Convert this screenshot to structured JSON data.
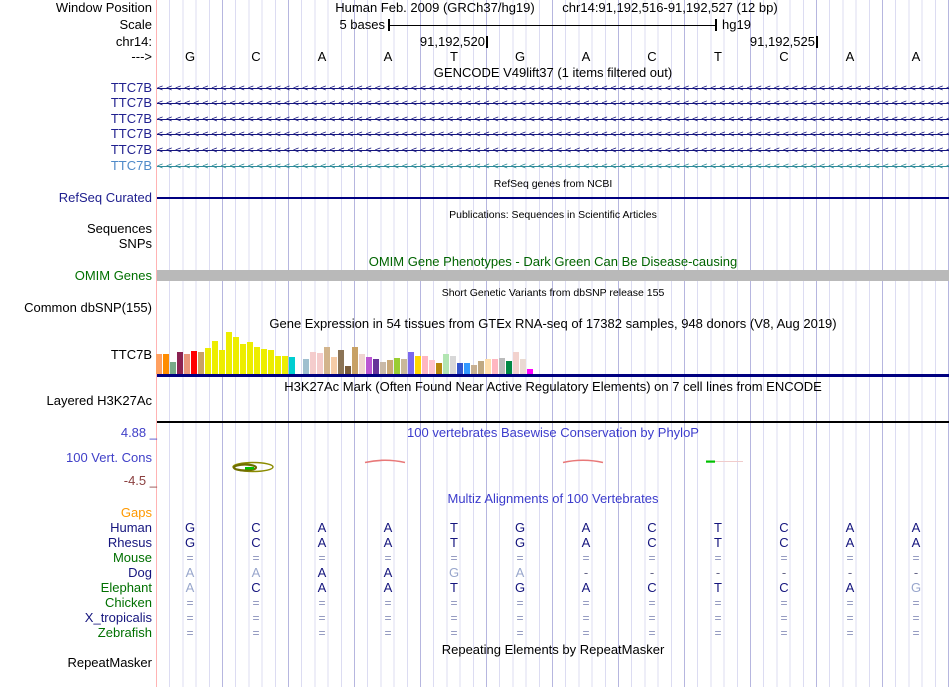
{
  "header": {
    "assembly_date": "Human Feb. 2009 (GRCh37/hg19)",
    "position": "chr14:91,192,516-91,192,527 (12 bp)",
    "scale_value": "5 bases",
    "assembly_short": "hg19",
    "coord_left": "91,192,520",
    "coord_right": "91,192,525",
    "left_labels": {
      "window_position": "Window Position",
      "scale": "Scale",
      "chrom": "chr14:",
      "strand_arrow": "--->"
    }
  },
  "bases": [
    "G",
    "C",
    "A",
    "A",
    "T",
    "G",
    "A",
    "C",
    "T",
    "C",
    "A",
    "A"
  ],
  "gencode": {
    "title": "GENCODE V49lift37 (1 items filtered out)",
    "arrow_char": "<",
    "rows": [
      {
        "label": "TTC7B",
        "label_color": "#20208f",
        "line_color": "#15157e"
      },
      {
        "label": "TTC7B",
        "label_color": "#20208f",
        "line_color": "#15157e"
      },
      {
        "label": "TTC7B",
        "label_color": "#20208f",
        "line_color": "#15157e"
      },
      {
        "label": "TTC7B",
        "label_color": "#20208f",
        "line_color": "#15157e"
      },
      {
        "label": "TTC7B",
        "label_color": "#20208f",
        "line_color": "#15157e"
      },
      {
        "label": "TTC7B",
        "label_color": "#4f8ac8",
        "line_color": "#2e8b99"
      }
    ]
  },
  "refseq": {
    "title": "RefSeq genes from NCBI",
    "label": "RefSeq Curated",
    "line_color": "#000080"
  },
  "publications": {
    "title": "Publications: Sequences in Scientific Articles",
    "label_sequences": "Sequences",
    "label_snps": "SNPs"
  },
  "omim": {
    "title": "OMIM Gene Phenotypes - Dark Green Can Be Disease-causing",
    "label": "OMIM Genes",
    "title_color": "#006400",
    "label_color": "#007000",
    "bar_color": "#b9b9b9"
  },
  "dbsnp": {
    "title": "Short Genetic Variants from dbSNP release 155",
    "label": "Common dbSNP(155)"
  },
  "gtex": {
    "title": "Gene Expression in 54 tissues from GTEx RNA-seq of 17382 samples, 948 donors (V8, Aug 2019)",
    "label": "TTC7B",
    "baseline_color": "#000080",
    "bars": [
      {
        "c": "#FFA060",
        "h": 20
      },
      {
        "c": "#FF8C00",
        "h": 20
      },
      {
        "c": "#77AA88",
        "h": 12
      },
      {
        "c": "#8B2252",
        "h": 22
      },
      {
        "c": "#E9967A",
        "h": 20
      },
      {
        "c": "#FF0000",
        "h": 23
      },
      {
        "c": "#C8A165",
        "h": 22
      },
      {
        "c": "#EDED00",
        "h": 26
      },
      {
        "c": "#EDED00",
        "h": 33
      },
      {
        "c": "#EDED00",
        "h": 24
      },
      {
        "c": "#EDED00",
        "h": 42
      },
      {
        "c": "#EDED00",
        "h": 37
      },
      {
        "c": "#EDED00",
        "h": 30
      },
      {
        "c": "#EDED00",
        "h": 32
      },
      {
        "c": "#EDED00",
        "h": 27
      },
      {
        "c": "#EDED00",
        "h": 25
      },
      {
        "c": "#EDED00",
        "h": 24
      },
      {
        "c": "#EDED00",
        "h": 18
      },
      {
        "c": "#EDED00",
        "h": 18
      },
      {
        "c": "#00CED1",
        "h": 17
      },
      {
        "c": "#FFFFFF",
        "h": 0
      },
      {
        "c": "#9FBFCF",
        "h": 15
      },
      {
        "c": "#F4CCCC",
        "h": 22
      },
      {
        "c": "#F4CCCC",
        "h": 21
      },
      {
        "c": "#D2B48C",
        "h": 27
      },
      {
        "c": "#F5CBA7",
        "h": 17
      },
      {
        "c": "#8B7355",
        "h": 24
      },
      {
        "c": "#7A5C3A",
        "h": 8
      },
      {
        "c": "#C8A165",
        "h": 27
      },
      {
        "c": "#EFD5D0",
        "h": 20
      },
      {
        "c": "#BA55D3",
        "h": 17
      },
      {
        "c": "#663399",
        "h": 15
      },
      {
        "c": "#C9B9A8",
        "h": 12
      },
      {
        "c": "#C9A878",
        "h": 14
      },
      {
        "c": "#9ACD32",
        "h": 16
      },
      {
        "c": "#C8B89A",
        "h": 15
      },
      {
        "c": "#7B68EE",
        "h": 22
      },
      {
        "c": "#FFD700",
        "h": 18
      },
      {
        "c": "#FFB6C1",
        "h": 18
      },
      {
        "c": "#FFC4CE",
        "h": 14
      },
      {
        "c": "#B8860B",
        "h": 11
      },
      {
        "c": "#B2E5B2",
        "h": 20
      },
      {
        "c": "#D8D8D8",
        "h": 18
      },
      {
        "c": "#3355CC",
        "h": 11
      },
      {
        "c": "#3399FF",
        "h": 11
      },
      {
        "c": "#C8B092",
        "h": 9
      },
      {
        "c": "#C0A882",
        "h": 13
      },
      {
        "c": "#FFDEAD",
        "h": 15
      },
      {
        "c": "#FFB6C1",
        "h": 15
      },
      {
        "c": "#BBBBBB",
        "h": 16
      },
      {
        "c": "#008844",
        "h": 13
      },
      {
        "c": "#F2D2CE",
        "h": 22
      },
      {
        "c": "#EADAD2",
        "h": 15
      },
      {
        "c": "#FF00FF",
        "h": 5
      }
    ]
  },
  "h3k27ac": {
    "title": "H3K27Ac Mark (Often Found Near Active Regulatory Elements) on 7 cell lines from ENCODE",
    "label": "Layered H3K27Ac"
  },
  "conservation": {
    "title": "100 vertebrates Basewise Conservation by PhyloP",
    "label": "100 Vert. Cons",
    "max_label": "4.88 _",
    "min_label": "-4.5 _",
    "title_color": "#3c3ccc",
    "max_color": "#4040c8",
    "min_color": "#8b4040"
  },
  "multiz": {
    "title": "Multiz Alignments of 100 Vertebrates",
    "title_color": "#3c3ccc",
    "gaps_label": "Gaps",
    "gaps_color": "#ff9900",
    "rows": [
      {
        "label": "Human",
        "label_color": "#15157e",
        "cells": [
          {
            "t": "G",
            "s": "dark"
          },
          {
            "t": "C",
            "s": "dark"
          },
          {
            "t": "A",
            "s": "dark"
          },
          {
            "t": "A",
            "s": "dark"
          },
          {
            "t": "T",
            "s": "dark"
          },
          {
            "t": "G",
            "s": "dark"
          },
          {
            "t": "A",
            "s": "dark"
          },
          {
            "t": "C",
            "s": "dark"
          },
          {
            "t": "T",
            "s": "dark"
          },
          {
            "t": "C",
            "s": "dark"
          },
          {
            "t": "A",
            "s": "dark"
          },
          {
            "t": "A",
            "s": "dark"
          }
        ]
      },
      {
        "label": "Rhesus",
        "label_color": "#15157e",
        "cells": [
          {
            "t": "G",
            "s": "dark"
          },
          {
            "t": "C",
            "s": "dark"
          },
          {
            "t": "A",
            "s": "dark"
          },
          {
            "t": "A",
            "s": "dark"
          },
          {
            "t": "T",
            "s": "dark"
          },
          {
            "t": "G",
            "s": "dark"
          },
          {
            "t": "A",
            "s": "dark"
          },
          {
            "t": "C",
            "s": "dark"
          },
          {
            "t": "T",
            "s": "dark"
          },
          {
            "t": "C",
            "s": "dark"
          },
          {
            "t": "A",
            "s": "dark"
          },
          {
            "t": "A",
            "s": "dark"
          }
        ]
      },
      {
        "label": "Mouse",
        "label_color": "#007000",
        "cells": [
          {
            "t": "=",
            "s": "eq"
          },
          {
            "t": "=",
            "s": "eq"
          },
          {
            "t": "=",
            "s": "eq"
          },
          {
            "t": "=",
            "s": "eq"
          },
          {
            "t": "=",
            "s": "eq"
          },
          {
            "t": "=",
            "s": "eq"
          },
          {
            "t": "=",
            "s": "eq"
          },
          {
            "t": "=",
            "s": "eq"
          },
          {
            "t": "=",
            "s": "eq"
          },
          {
            "t": "=",
            "s": "eq"
          },
          {
            "t": "=",
            "s": "eq"
          },
          {
            "t": "=",
            "s": "eq"
          }
        ]
      },
      {
        "label": "Dog",
        "label_color": "#15157e",
        "cells": [
          {
            "t": "A",
            "s": "light"
          },
          {
            "t": "A",
            "s": "light"
          },
          {
            "t": "A",
            "s": "dark"
          },
          {
            "t": "A",
            "s": "dark"
          },
          {
            "t": "G",
            "s": "light"
          },
          {
            "t": "A",
            "s": "light"
          },
          {
            "t": "-",
            "s": "dot"
          },
          {
            "t": "-",
            "s": "dot"
          },
          {
            "t": "-",
            "s": "dot"
          },
          {
            "t": "-",
            "s": "dot"
          },
          {
            "t": "-",
            "s": "dot"
          },
          {
            "t": "-",
            "s": "dot"
          }
        ]
      },
      {
        "label": "Elephant",
        "label_color": "#007000",
        "cells": [
          {
            "t": "A",
            "s": "light"
          },
          {
            "t": "C",
            "s": "dark"
          },
          {
            "t": "A",
            "s": "dark"
          },
          {
            "t": "A",
            "s": "dark"
          },
          {
            "t": "T",
            "s": "dark"
          },
          {
            "t": "G",
            "s": "dark"
          },
          {
            "t": "A",
            "s": "dark"
          },
          {
            "t": "C",
            "s": "dark"
          },
          {
            "t": "T",
            "s": "dark"
          },
          {
            "t": "C",
            "s": "dark"
          },
          {
            "t": "A",
            "s": "dark"
          },
          {
            "t": "G",
            "s": "light"
          }
        ]
      },
      {
        "label": "Chicken",
        "label_color": "#007000",
        "cells": [
          {
            "t": "=",
            "s": "eq"
          },
          {
            "t": "=",
            "s": "eq"
          },
          {
            "t": "=",
            "s": "eq"
          },
          {
            "t": "=",
            "s": "eq"
          },
          {
            "t": "=",
            "s": "eq"
          },
          {
            "t": "=",
            "s": "eq"
          },
          {
            "t": "=",
            "s": "eq"
          },
          {
            "t": "=",
            "s": "eq"
          },
          {
            "t": "=",
            "s": "eq"
          },
          {
            "t": "=",
            "s": "eq"
          },
          {
            "t": "=",
            "s": "eq"
          },
          {
            "t": "=",
            "s": "eq"
          }
        ]
      },
      {
        "label": "X_tropicalis",
        "label_color": "#15157e",
        "cells": [
          {
            "t": "=",
            "s": "eq"
          },
          {
            "t": "=",
            "s": "eq"
          },
          {
            "t": "=",
            "s": "eq"
          },
          {
            "t": "=",
            "s": "eq"
          },
          {
            "t": "=",
            "s": "eq"
          },
          {
            "t": "=",
            "s": "eq"
          },
          {
            "t": "=",
            "s": "eq"
          },
          {
            "t": "=",
            "s": "eq"
          },
          {
            "t": "=",
            "s": "eq"
          },
          {
            "t": "=",
            "s": "eq"
          },
          {
            "t": "=",
            "s": "eq"
          },
          {
            "t": "=",
            "s": "eq"
          }
        ]
      },
      {
        "label": "Zebrafish",
        "label_color": "#007000",
        "cells": [
          {
            "t": "=",
            "s": "eq"
          },
          {
            "t": "=",
            "s": "eq"
          },
          {
            "t": "=",
            "s": "eq"
          },
          {
            "t": "=",
            "s": "eq"
          },
          {
            "t": "=",
            "s": "eq"
          },
          {
            "t": "=",
            "s": "eq"
          },
          {
            "t": "=",
            "s": "eq"
          },
          {
            "t": "=",
            "s": "eq"
          },
          {
            "t": "=",
            "s": "eq"
          },
          {
            "t": "=",
            "s": "eq"
          },
          {
            "t": "=",
            "s": "eq"
          },
          {
            "t": "=",
            "s": "eq"
          }
        ]
      }
    ]
  },
  "repeatmasker": {
    "title": "Repeating Elements by RepeatMasker",
    "label": "RepeatMasker"
  }
}
